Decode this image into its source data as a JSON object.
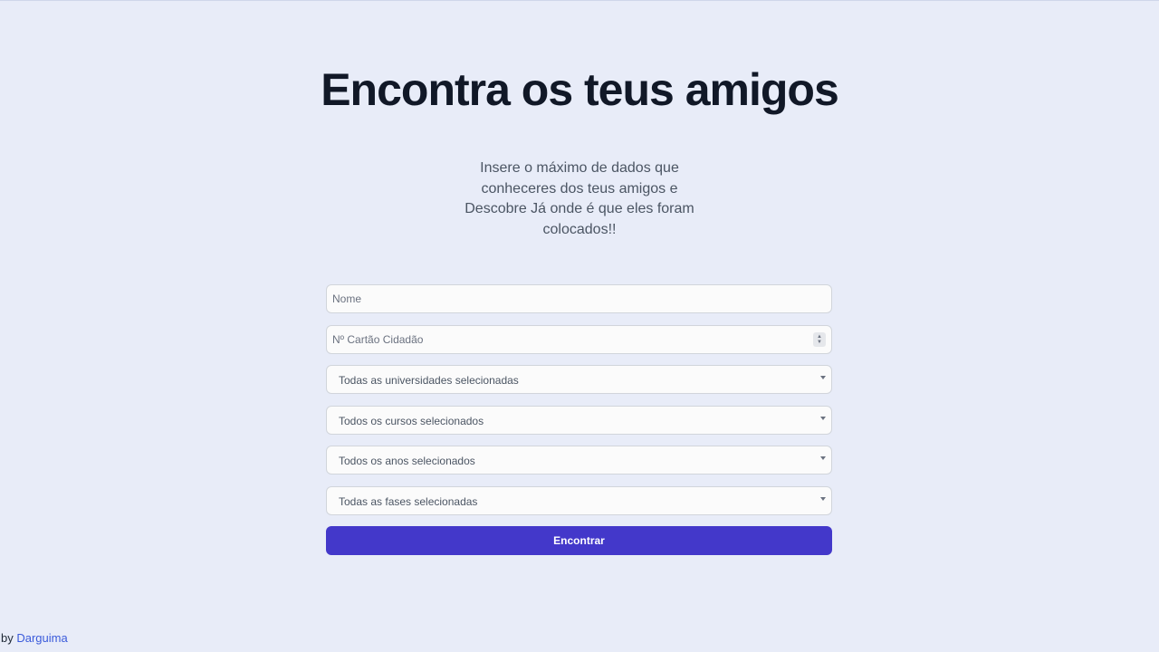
{
  "header": {
    "title": "Encontra os teus amigos",
    "subtitle": "Insere o máximo de dados que conheceres dos teus amigos e Descobre Já onde é que eles foram colocados!!"
  },
  "form": {
    "name_placeholder": "Nome",
    "card_placeholder": "Nº Cartão Cidadão",
    "university_select": "Todas as universidades selecionadas",
    "course_select": "Todos os cursos selecionados",
    "year_select": "Todos os anos selecionados",
    "phase_select": "Todas as fases selecionadas",
    "submit_label": "Encontrar"
  },
  "footer": {
    "prefix": "by",
    "author": "Darguima"
  },
  "colors": {
    "background": "#e8ecf8",
    "accent": "#4338ca",
    "link": "#3b5bdb"
  }
}
